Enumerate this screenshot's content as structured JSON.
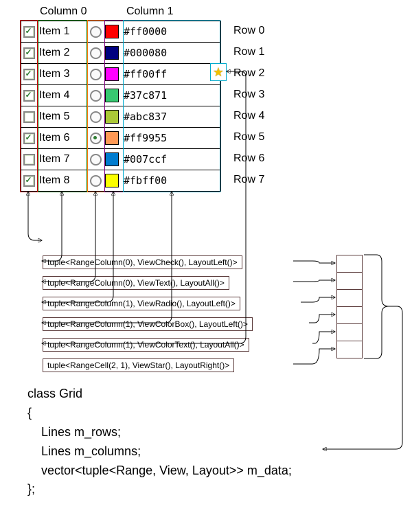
{
  "headers": {
    "col0": "Column 0",
    "col1": "Column 1"
  },
  "rows": [
    {
      "checked": true,
      "item": "Item 1",
      "radio": false,
      "color": "#ff0000",
      "hex": "#ff0000",
      "label": "Row 0"
    },
    {
      "checked": true,
      "item": "Item 2",
      "radio": false,
      "color": "#000080",
      "hex": "#000080",
      "label": "Row 1"
    },
    {
      "checked": true,
      "item": "Item 3",
      "radio": false,
      "color": "#ff00ff",
      "hex": "#ff00ff",
      "label": "Row 2"
    },
    {
      "checked": true,
      "item": "Item 4",
      "radio": false,
      "color": "#37c871",
      "hex": "#37c871",
      "label": "Row 3"
    },
    {
      "checked": false,
      "item": "Item 5",
      "radio": false,
      "color": "#abc837",
      "hex": "#abc837",
      "label": "Row 4"
    },
    {
      "checked": true,
      "item": "Item 6",
      "radio": true,
      "color": "#ff9955",
      "hex": "#ff9955",
      "label": "Row 5"
    },
    {
      "checked": false,
      "item": "Item 7",
      "radio": false,
      "color": "#007ccf",
      "hex": "#007ccf",
      "label": "Row 6"
    },
    {
      "checked": true,
      "item": "Item 8",
      "radio": false,
      "color": "#fbff00",
      "hex": "#fbff00",
      "label": "Row 7"
    }
  ],
  "tuples": [
    "tuple<RangeColumn(0), ViewCheck(), LayoutLeft()>",
    "tuple<RangeColumn(0), ViewText(), LayoutAll()>",
    "tuple<RangeColumn(1), ViewRadio(), LayoutLeft()>",
    "tuple<RangeColumn(1), ViewColorBox(), LayoutLeft()>",
    "tuple<RangeColumn(1), ViewColorText(), LayoutAll()>",
    "tuple<RangeCell(2, 1), ViewStar(), LayoutRight()>"
  ],
  "code": "class Grid\n{\n    Lines m_rows;\n    Lines m_columns;\n    vector<tuple<Range, View, Layout>> m_data;\n};"
}
